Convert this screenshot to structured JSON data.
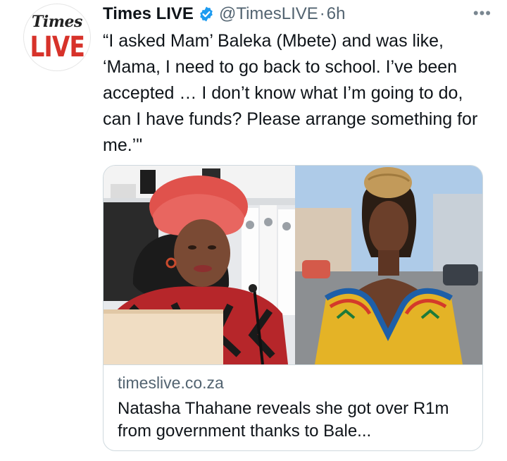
{
  "account": {
    "avatar_top": "Times",
    "avatar_bottom": "LIVE",
    "name": "Times LIVE",
    "handle": "@TimesLIVE",
    "separator": "·",
    "time": "6h"
  },
  "more_label": "•••",
  "tweet": {
    "text": "“I asked Mam’ Baleka (Mbete) and was like, ‘Mama, I need to go back to school. I’ve been accepted … I don’t know what I’m going to do, can I have funds? Please arrange something for me.’\""
  },
  "link_card": {
    "domain": "timeslive.co.za",
    "title": "Natasha Thahane reveals she got over R1m from government thanks to Bale..."
  },
  "colors": {
    "verified_blue": "#1d9bf0",
    "brand_red": "#d7322a",
    "secondary_text": "#536471",
    "border": "#cfd9de"
  }
}
